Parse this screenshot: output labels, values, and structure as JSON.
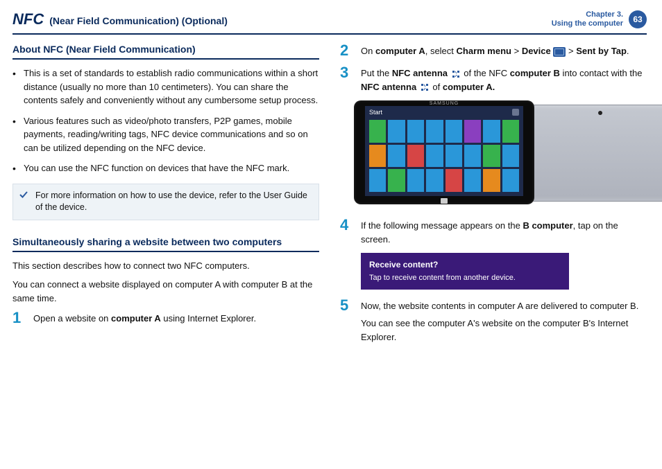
{
  "header": {
    "title_main": "NFC",
    "title_sub": "(Near Field Communication) (Optional)",
    "chapter_line1": "Chapter 3.",
    "chapter_line2": "Using the computer",
    "page_no": "63"
  },
  "left": {
    "h_about": "About NFC (Near Field Communication)",
    "bullets": {
      "b1": "This is a set of standards to establish radio communications within a short distance (usually no more than 10 centimeters). You can share the contents safely and conveniently without any cumbersome setup process.",
      "b2": "Various features such as video/photo transfers, P2P games, mobile payments, reading/writing tags, NFC device communications and so on can be utilized depending on the NFC device.",
      "b3": "You can use the NFC function on devices that have the NFC mark."
    },
    "note": "For more information on how to use the device, refer to the User Guide of the device.",
    "h_share": "Simultaneously sharing a website between two computers",
    "intro1": "This section describes how to connect two NFC computers.",
    "intro2": "You can connect a website displayed on computer A with computer B at the same time.",
    "step1": {
      "t1": "Open a website on ",
      "b1": "computer A",
      "t2": " using Internet Explorer."
    }
  },
  "right": {
    "step2": {
      "t1": "On ",
      "b1": "computer A",
      "t2": ", select ",
      "b2": "Charm menu",
      "gt1": " > ",
      "b3": "Device",
      "gt2": " > ",
      "b4": "Sent by Tap",
      "dot": "."
    },
    "step3": {
      "t1": "Put the ",
      "b1": "NFC antenna",
      "t2": " of the NFC ",
      "b2": "computer B",
      "t3": " into contact with the ",
      "b3": "NFC antenna",
      "t4": " of ",
      "b4": "computer A."
    },
    "tablet": {
      "brand": "SAMSUNG",
      "start": "Start"
    },
    "step4": {
      "t1": "If the following message appears on the ",
      "b1": "B computer",
      "t2": ", tap on the screen."
    },
    "msg": {
      "title": "Receive content?",
      "body": "Tap to receive content from another device."
    },
    "step5": {
      "p1": "Now, the website contents in computer A are delivered to computer B.",
      "p2": "You can see the computer A's website on the computer B's Internet Explorer."
    },
    "tile_colors": [
      "#37b24d",
      "#2a97d9",
      "#2a97d9",
      "#2a97d9",
      "#2a97d9",
      "#8a3fbf",
      "#2a97d9",
      "#37b24d",
      "#e68a1e",
      "#2a97d9",
      "#d64545",
      "#2a97d9",
      "#2a97d9",
      "#2a97d9",
      "#37b24d",
      "#2a97d9",
      "#2a97d9",
      "#37b24d",
      "#2a97d9",
      "#2a97d9",
      "#d64545",
      "#2a97d9",
      "#e68a1e",
      "#2a97d9"
    ]
  }
}
